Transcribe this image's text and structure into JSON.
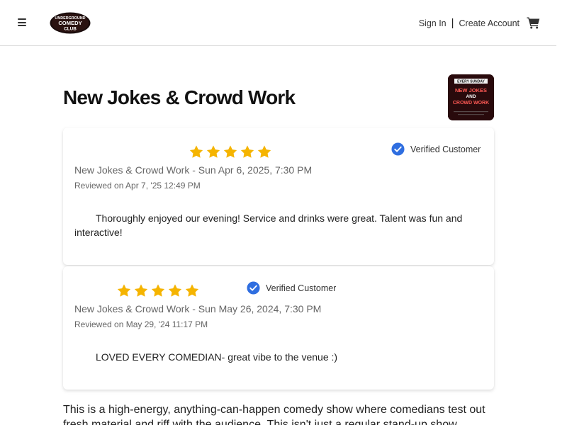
{
  "header": {
    "logo_text": [
      "UNDERGROUND",
      "COMEDY",
      "CLUB"
    ],
    "sign_in": "Sign In",
    "separator": "|",
    "create_account": "Create Account"
  },
  "event": {
    "title": "New Jokes & Crowd Work",
    "thumbnail_text": [
      "EVERY SUNDAY",
      "NEW JOKES",
      "AND",
      "CROWD WORK"
    ]
  },
  "reviews": [
    {
      "rating": 5,
      "verified_label": "Verified Customer",
      "event_line": "New Jokes & Crowd Work - Sun Apr 6, 2025, 7:30 PM",
      "reviewed_on": "Reviewed on Apr 7, '25 12:49 PM",
      "text": "Thoroughly enjoyed our evening! Service and drinks were great. Talent was fun and interactive!"
    },
    {
      "rating": 5,
      "verified_label": "Verified Customer",
      "event_line": "New Jokes & Crowd Work - Sun May 26, 2024, 7:30 PM",
      "reviewed_on": "Reviewed on May 29, '24 11:17 PM",
      "text": "LOVED EVERY COMEDIAN- great vibe to the venue :)"
    }
  ],
  "description": "This is a high-energy, anything-can-happen comedy show where comedians test out fresh material and riff with the audience. This isn't just a regular stand-up show",
  "colors": {
    "star": "#f5b400",
    "verified_badge": "#2f6ee0"
  }
}
